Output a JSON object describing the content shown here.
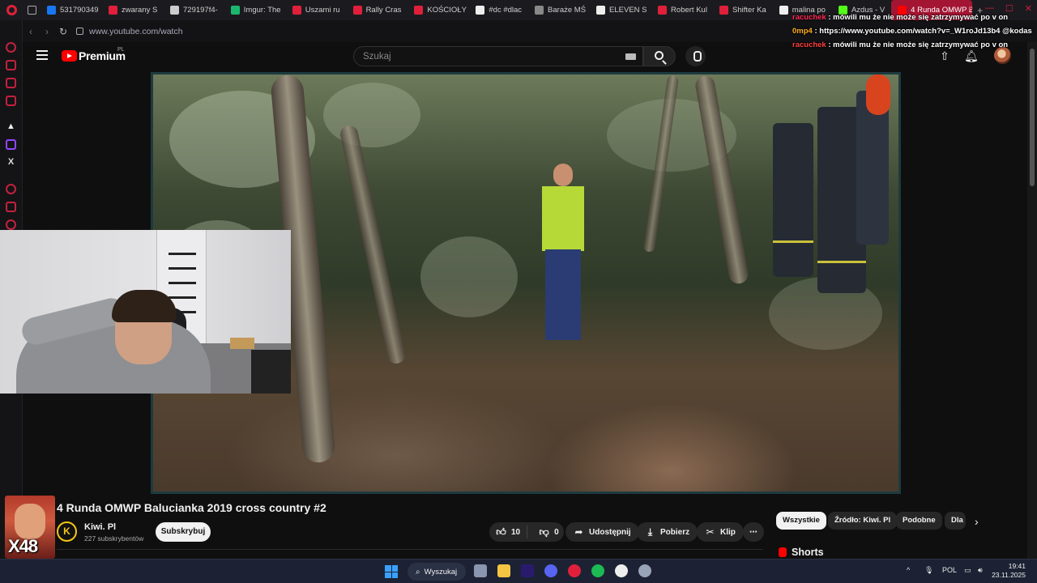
{
  "browser": {
    "tabs": [
      {
        "label": "531790349",
        "color": "#1877f2"
      },
      {
        "label": "zwarany S",
        "color": "#e0203a"
      },
      {
        "label": "729197f4-",
        "color": "#cccccc"
      },
      {
        "label": "Imgur: The",
        "color": "#1bb76e"
      },
      {
        "label": "Uszami ru",
        "color": "#e0203a"
      },
      {
        "label": "Rally Cras",
        "color": "#e0203a"
      },
      {
        "label": "KOŚCIOŁY",
        "color": "#e0203a"
      },
      {
        "label": "#dc #dlac",
        "color": "#eeeeee"
      },
      {
        "label": "Baraże MŚ",
        "color": "#888888"
      },
      {
        "label": "ELEVEN S",
        "color": "#eeeeee"
      },
      {
        "label": "Robert Kul",
        "color": "#e0203a"
      },
      {
        "label": "Shifter Ka",
        "color": "#e0203a"
      },
      {
        "label": "malina po",
        "color": "#eeeeee"
      },
      {
        "label": "Azdus - V",
        "color": "#53fc18"
      }
    ],
    "active_tab": "4 Runda OMWP Ba",
    "url": "www.youtube.com/watch"
  },
  "youtube": {
    "brand": "Premium",
    "country": "PL",
    "search_placeholder": "Szukaj"
  },
  "chat": [
    {
      "nick": "racuchek",
      "message": ": mówili mu że nie może się zatrzymywać po v on"
    },
    {
      "nick": "0mp4",
      "message": ": https://www.youtube.com/watch?v=_W1roJd13b4 @kodas"
    },
    {
      "nick": "racuchek",
      "message": ": mówili mu że nie może się zatrzymywać po v on"
    }
  ],
  "emote": {
    "label": "X48"
  },
  "video": {
    "title": "4 Runda OMWP Balucianka 2019 cross country #2",
    "channel_initial": "K",
    "channel": "Kiwi. Pl",
    "subscribers": "227 subskrybentów",
    "subscribe_label": "Subskrybuj",
    "likes": "10",
    "dislikes": "0",
    "share_label": "Udostępnij",
    "download_label": "Pobierz",
    "clip_label": "Klip",
    "more_label": "⋯"
  },
  "chips": [
    "Wszystkie",
    "Źródło: Kiwi. Pl",
    "Podobne",
    "Dla"
  ],
  "shorts_label": "Shorts",
  "taskbar": {
    "search_label": "Wyszukaj",
    "language": "POL",
    "time": "19:41",
    "date": "23.11.2025",
    "apps": [
      {
        "icon": "explorer-icon",
        "color": "#8a96b0"
      },
      {
        "icon": "folder-icon",
        "color": "#f4c542"
      },
      {
        "icon": "premiere-icon",
        "color": "#2a1a6e"
      },
      {
        "icon": "discord-icon",
        "color": "#5865f2"
      },
      {
        "icon": "opera-icon",
        "color": "#e0203a"
      },
      {
        "icon": "spotify-icon",
        "color": "#1db954"
      },
      {
        "icon": "github-icon",
        "color": "#eeeeee"
      },
      {
        "icon": "steam-icon",
        "color": "#9aa4b8"
      }
    ]
  }
}
